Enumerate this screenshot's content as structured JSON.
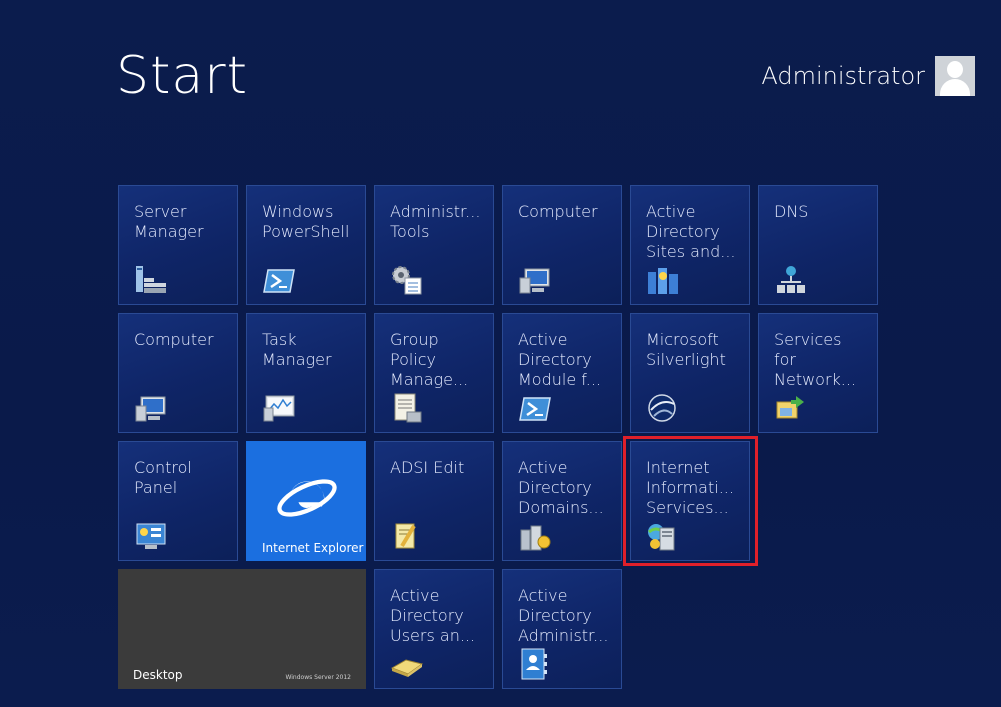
{
  "start": {
    "title": "Start"
  },
  "user": {
    "name": "Administrator"
  },
  "tiles": [
    {
      "label": "Server\nManager",
      "icon": "server-manager-icon"
    },
    {
      "label": "Windows\nPowerShell",
      "icon": "powershell-icon"
    },
    {
      "label": "Administr...\nTools",
      "icon": "admin-tools-icon"
    },
    {
      "label": "Computer",
      "icon": "computer-icon"
    },
    {
      "label": "Active\nDirectory\nSites and...",
      "icon": "ad-sites-icon"
    },
    {
      "label": "DNS",
      "icon": "dns-icon"
    },
    {
      "label": "Computer",
      "icon": "computer-icon"
    },
    {
      "label": "Task\nManager",
      "icon": "task-manager-icon"
    },
    {
      "label": "Group\nPolicy\nManage...",
      "icon": "group-policy-icon"
    },
    {
      "label": "Active\nDirectory\nModule f...",
      "icon": "powershell-icon"
    },
    {
      "label": "Microsoft\nSilverlight",
      "icon": "silverlight-icon"
    },
    {
      "label": "Services\nfor\nNetwork...",
      "icon": "services-network-icon"
    },
    {
      "label": "Control\nPanel",
      "icon": "control-panel-icon"
    },
    {
      "label": "Internet Explorer",
      "icon": "internet-explorer-icon"
    },
    {
      "label": "ADSI Edit",
      "icon": "adsi-edit-icon"
    },
    {
      "label": "Active\nDirectory\nDomains...",
      "icon": "ad-domains-icon"
    },
    {
      "label": "Internet\nInformati...\nServices...",
      "icon": "iis-icon"
    },
    {
      "label": "Desktop",
      "brand": "Windows Server 2012",
      "icon": "desktop-icon"
    },
    {
      "label": "Active\nDirectory\nUsers an...",
      "icon": "ad-users-icon"
    },
    {
      "label": "Active\nDirectory\nAdministr...",
      "icon": "ad-admin-center-icon"
    }
  ],
  "colors": {
    "background": "#0b1c4d",
    "tile": "#112a70",
    "ie_tile": "#1b6fe0",
    "desktop_tile": "#3b3b3b",
    "highlight": "#e0202a"
  }
}
